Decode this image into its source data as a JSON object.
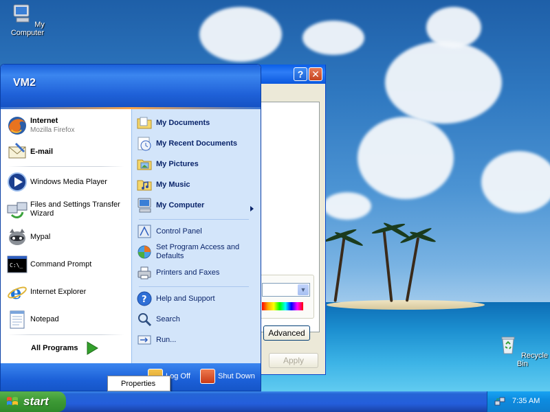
{
  "desktop": {
    "icons": [
      {
        "label": "My Computer",
        "icon": "my-computer-icon"
      },
      {
        "label": "Recycle Bin",
        "icon": "recycle-bin-icon"
      }
    ]
  },
  "dialog": {
    "help_glyph": "?",
    "close_glyph": "✕",
    "advanced_label": "Advanced",
    "apply_label": "Apply"
  },
  "start_menu": {
    "user_name": "VM2",
    "pinned": [
      {
        "title": "Internet",
        "subtitle": "Mozilla Firefox",
        "icon": "firefox-icon"
      },
      {
        "title": "E-mail",
        "icon": "email-icon"
      }
    ],
    "recent": [
      {
        "label": "Windows Media Player",
        "icon": "media-player-icon"
      },
      {
        "label": "Files and Settings Transfer Wizard",
        "icon": "transfer-wizard-icon"
      },
      {
        "label": "Mypal",
        "icon": "mypal-icon"
      },
      {
        "label": "Command Prompt",
        "icon": "command-prompt-icon"
      },
      {
        "label": "Internet Explorer",
        "icon": "internet-explorer-icon"
      },
      {
        "label": "Notepad",
        "icon": "notepad-icon"
      }
    ],
    "all_programs_label": "All Programs",
    "places": [
      {
        "label": "My Documents",
        "icon": "my-documents-icon"
      },
      {
        "label": "My Recent Documents",
        "icon": "recent-documents-icon"
      },
      {
        "label": "My Pictures",
        "icon": "my-pictures-icon"
      },
      {
        "label": "My Music",
        "icon": "my-music-icon"
      },
      {
        "label": "My Computer",
        "icon": "my-computer-icon"
      }
    ],
    "system": [
      {
        "label": "Control Panel",
        "icon": "control-panel-icon"
      },
      {
        "label": "Set Program Access and Defaults",
        "icon": "program-access-icon"
      },
      {
        "label": "Printers and Faxes",
        "icon": "printer-icon"
      }
    ],
    "help": [
      {
        "label": "Help and Support",
        "icon": "help-icon"
      },
      {
        "label": "Search",
        "icon": "search-icon"
      },
      {
        "label": "Run...",
        "icon": "run-icon"
      }
    ],
    "log_off_label": "Log Off",
    "shut_down_label": "Shut Down"
  },
  "context_menu": {
    "item": "Properties"
  },
  "taskbar": {
    "start_label": "start",
    "clock": "7:35 AM"
  },
  "colors": {
    "xp_blue": "#245edb",
    "start_green": "#3e9a36",
    "tray_blue": "#0d8ce0"
  }
}
